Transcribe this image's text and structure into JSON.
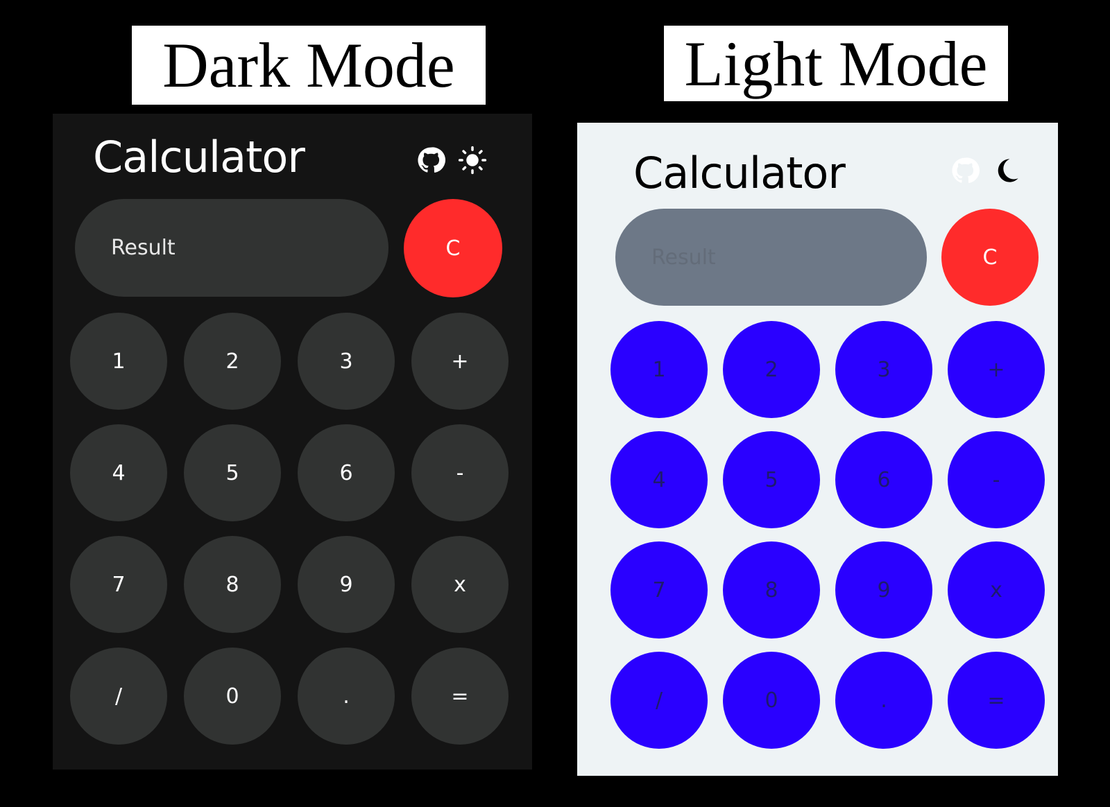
{
  "labels": {
    "dark": "Dark Mode",
    "light": "Light Mode"
  },
  "dark": {
    "title": "Calculator",
    "result_placeholder": "Result",
    "clear_label": "C",
    "icons": [
      "github-icon",
      "sun-icon"
    ],
    "colors": {
      "background": "#141414",
      "key": "#313332",
      "text": "#ffffff",
      "clear": "#ff2b2b"
    },
    "keys": [
      "1",
      "2",
      "3",
      "+",
      "4",
      "5",
      "6",
      "-",
      "7",
      "8",
      "9",
      "x",
      "/",
      "0",
      ".",
      "="
    ]
  },
  "light": {
    "title": "Calculator",
    "result_placeholder": "Result",
    "clear_label": "C",
    "icons": [
      "github-icon",
      "moon-icon"
    ],
    "colors": {
      "background": "#eef3f5",
      "result": "#6d7887",
      "key": "#2a00ff",
      "text": "#000000",
      "clear": "#ff2b2b"
    },
    "keys": [
      "1",
      "2",
      "3",
      "+",
      "4",
      "5",
      "6",
      "-",
      "7",
      "8",
      "9",
      "x",
      "/",
      "0",
      ".",
      "="
    ]
  }
}
